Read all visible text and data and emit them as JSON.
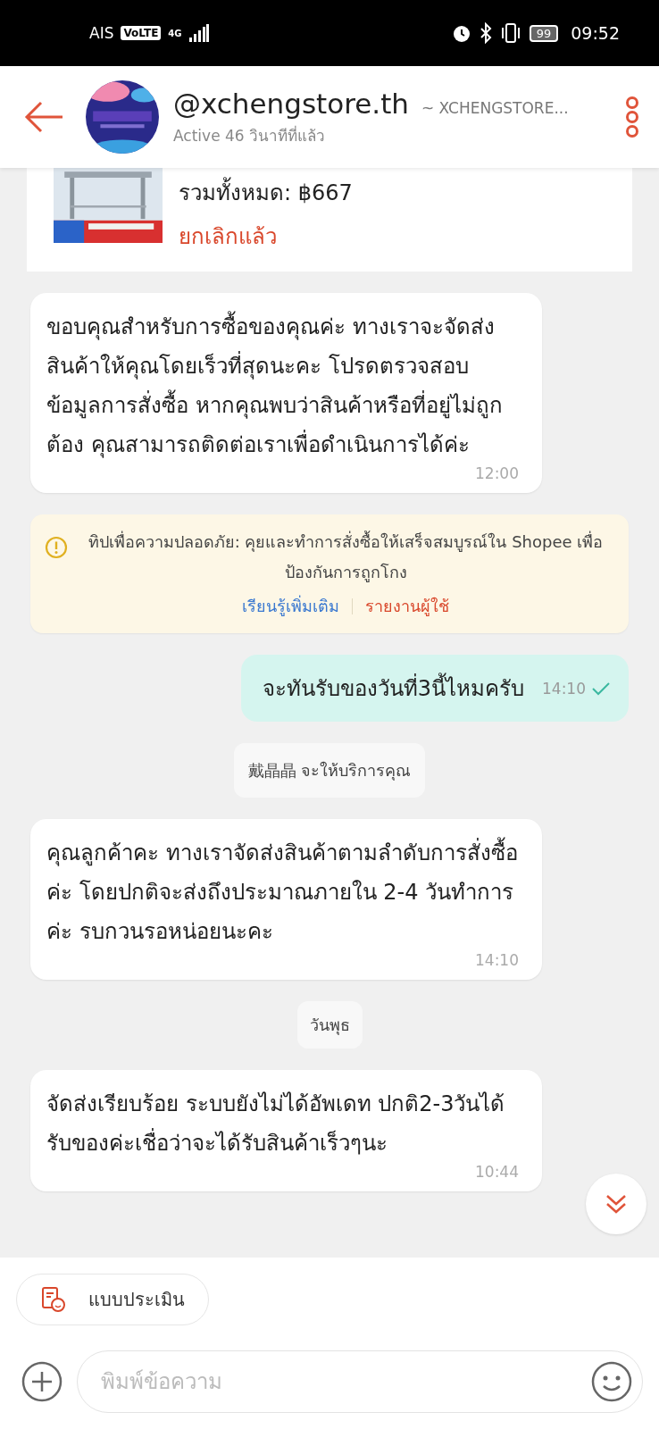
{
  "status_bar": {
    "carrier": "AIS",
    "volte": "VoLTE",
    "network": "4G",
    "battery": "99",
    "time": "09:52"
  },
  "header": {
    "name": "@xchengstore.th",
    "subtitle": "~ XCHENGSTORE...",
    "status": "Active 46 วินาทีที่แล้ว"
  },
  "order_card": {
    "total": "รวมทั้งหมด: ฿667",
    "status": "ยกเลิกแล้ว"
  },
  "messages": [
    {
      "kind": "received",
      "text": "ขอบคุณสำหรับการซื้อของคุณค่ะ ทางเราจะจัดส่งสินค้าให้คุณโดยเร็วที่สุดนะคะ โปรดตรวจสอบข้อมูลการสั่งซื้อ หากคุณพบว่าสินค้าหรือที่อยู่ไม่ถูกต้อง คุณสามารถติดต่อเราเพื่อดำเนินการได้ค่ะ",
      "time": "12:00"
    },
    {
      "kind": "tip",
      "text": "ทิปเพื่อความปลอดภัย: คุยและทำการสั่งซื้อให้เสร็จสมบูรณ์ใน Shopee เพื่อป้องกันการถูกโกง",
      "links": [
        {
          "label": "เรียนรู้เพิ่มเติม",
          "color": "#3a78d0"
        },
        {
          "label": "รายงานผู้ใช้",
          "color": "#d9472b"
        }
      ]
    },
    {
      "kind": "sent",
      "text": "จะทันรับของวันที่3นี้ไหมครับ",
      "time": "14:10",
      "read": true
    },
    {
      "kind": "system",
      "text": "戴晶晶 จะให้บริการคุณ"
    },
    {
      "kind": "received",
      "text": "คุณลูกค้าคะ ทางเราจัดส่งสินค้าตามลำดับการสั่งซื้อค่ะ โดยปกติจะส่งถึงประมาณภายใน 2-4 วันทำการค่ะ รบกวนรอหน่อยนะคะ",
      "time": "14:10"
    },
    {
      "kind": "date",
      "text": "วันพุธ"
    },
    {
      "kind": "received",
      "text": "จัดส่งเรียบร้อย ระบบยังไม่ได้อัพเดท ปกติ2-3วันได้รับของค่ะเชื่อว่าจะได้รับสินค้าเร็วๆนะ",
      "time": "10:44"
    }
  ],
  "quick_reply": {
    "label": "แบบประเมิน"
  },
  "composer": {
    "placeholder": "พิมพ์ข้อความ"
  }
}
